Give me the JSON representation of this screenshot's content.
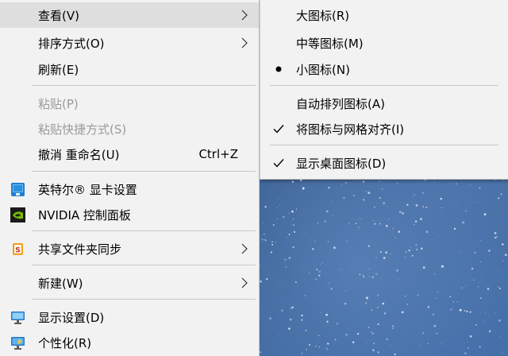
{
  "main_menu": {
    "view": "查看(V)",
    "sort": "排序方式(O)",
    "refresh": "刷新(E)",
    "paste": "粘贴(P)",
    "paste_shortcut": "粘贴快捷方式(S)",
    "undo_rename": "撤消 重命名(U)",
    "undo_rename_shortcut": "Ctrl+Z",
    "intel_graphics": "英特尔® 显卡设置",
    "nvidia_panel": "NVIDIA 控制面板",
    "share_sync": "共享文件夹同步",
    "new": "新建(W)",
    "display_settings": "显示设置(D)",
    "personalize": "个性化(R)"
  },
  "view_submenu": {
    "large_icons": "大图标(R)",
    "medium_icons": "中等图标(M)",
    "small_icons": "小图标(N)",
    "auto_arrange": "自动排列图标(A)",
    "align_to_grid": "将图标与网格对齐(I)",
    "show_desktop_icons": "显示桌面图标(D)"
  },
  "icons": {
    "arrow": "chevron-right-icon",
    "intel": "intel-graphics-icon",
    "nvidia": "nvidia-icon",
    "share": "share-sync-icon",
    "display": "display-icon",
    "personalize": "personalize-icon",
    "bullet": "radio-dot-icon",
    "check": "checkmark-icon"
  },
  "colors": {
    "menu_bg": "#f2f2f2",
    "hover_bg": "#dedede",
    "disabled_text": "#9a9a9a",
    "separator": "#c8c8c8"
  }
}
